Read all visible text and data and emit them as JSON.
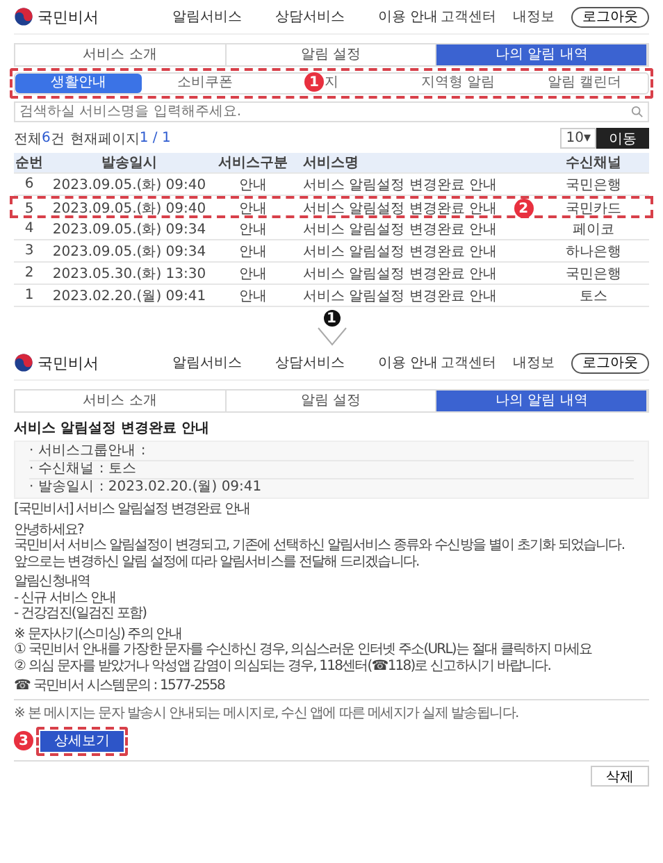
{
  "top": {
    "header": {
      "logo": "국민비서",
      "nav": [
        "알림서비스",
        "상담서비스",
        "이용 안내"
      ],
      "links": [
        "고객센터",
        "내정보"
      ],
      "logout": "로그아웃"
    },
    "tabs": [
      {
        "label": "서비스 소개",
        "selected": false
      },
      {
        "label": "알림 설정",
        "selected": false
      },
      {
        "label": "나의 알림 내역",
        "selected": true
      }
    ],
    "subtabs_badge": "1",
    "subtabs": [
      {
        "label": "생활안내",
        "selected": true
      },
      {
        "label": "소비쿠폰",
        "selected": false
      },
      {
        "label": "지",
        "selected": false
      },
      {
        "label": "지역형 알림",
        "selected": false
      },
      {
        "label": "알림 캘린더",
        "selected": false
      }
    ],
    "search": {
      "placeholder": "검색하실 서비스명을 입력해주세요."
    },
    "count": {
      "prefix": "전체",
      "total": "6",
      "suffix": "건",
      "page_label": "현재페이지",
      "page": "1 / 1"
    },
    "page_size": "10",
    "page_size_caret": "▾",
    "go_button": "이동",
    "table": {
      "columns": [
        "순번",
        "발송일시",
        "서비스구분",
        "서비스명",
        "수신채널"
      ],
      "highlight_badge": "2",
      "rows": [
        {
          "cells": [
            "6",
            "2023.09.05.(화) 09:40",
            "안내",
            "서비스 알림설정 변경완료 안내",
            "국민은행"
          ],
          "highlighted": false
        },
        {
          "cells": [
            "5",
            "2023.09.05.(화) 09:40",
            "안내",
            "서비스 알림설정 변경완료 안내",
            "국민카드"
          ],
          "highlighted": true
        },
        {
          "cells": [
            "4",
            "2023.09.05.(화) 09:34",
            "안내",
            "서비스 알림설정 변경완료 안내",
            "페이코"
          ],
          "highlighted": false
        },
        {
          "cells": [
            "3",
            "2023.09.05.(화) 09:34",
            "안내",
            "서비스 알림설정 변경완료 안내",
            "하나은행"
          ],
          "highlighted": false
        },
        {
          "cells": [
            "2",
            "2023.05.30.(화) 13:30",
            "안내",
            "서비스 알림설정 변경완료 안내",
            "국민은행"
          ],
          "highlighted": false
        },
        {
          "cells": [
            "1",
            "2023.02.20.(월) 09:41",
            "안내",
            "서비스 알림설정 변경완료 안내",
            "토스"
          ],
          "highlighted": false
        }
      ]
    }
  },
  "step_badge": "1",
  "detail": {
    "header": {
      "logo": "국민비서",
      "nav": [
        "알림서비스",
        "상담서비스",
        "이용 안내"
      ],
      "links": [
        "고객센터",
        "내정보"
      ],
      "logout": "로그아웃"
    },
    "tabs": [
      {
        "label": "서비스 소개",
        "selected": false
      },
      {
        "label": "알림 설정",
        "selected": false
      },
      {
        "label": "나의 알림 내역",
        "selected": true
      }
    ],
    "title": "서비스 알림설정 변경완료 안내",
    "info": [
      {
        "label": "· 서비스그룹안내",
        "value": ":"
      },
      {
        "label": "· 수신채널",
        "value": ": 토스"
      },
      {
        "label": "· 발송일시",
        "value": ": 2023.02.20.(월) 09:41"
      }
    ],
    "message": [
      [
        "[국민비서] 서비스 알림설정 변경완료 안내"
      ],
      [
        "안녕하세요?",
        "국민비서 서비스 알림설정이 변경되고, 기존에 선택하신 알림서비스 종류와 수신방을 별이 초기화 되었습니다.",
        "앞으로는 변경하신 알림 설정에 따라 알림서비스를 전달해 드리겠습니다."
      ],
      [
        "알림신청내역",
        "- 신규 서비스 안내",
        "- 건강검진(일검진 포함)"
      ],
      [
        "※ 문자사기(스미싱) 주의 안내",
        "① 국민비서 안내를 가장한 문자를 수신하신 경우, 의심스러운 인터넷 주소(URL)는 절대 클릭하지 마세요",
        "② 의심 문자를 받았거나 악성앱 감염이 의심되는 경우, 118센터(☎118)로 신고하시기 바랍니다."
      ],
      [
        "☎ 국민비서 시스템문의 : 1577-2558"
      ]
    ],
    "footnote": "※ 본 메시지는 문자 발송시 안내되는 메시지로, 수신 앱에 따른 메세지가 실제 발송됩니다.",
    "detail_badge": "3",
    "detail_button": "상세보기",
    "delete_button": "삭제"
  }
}
